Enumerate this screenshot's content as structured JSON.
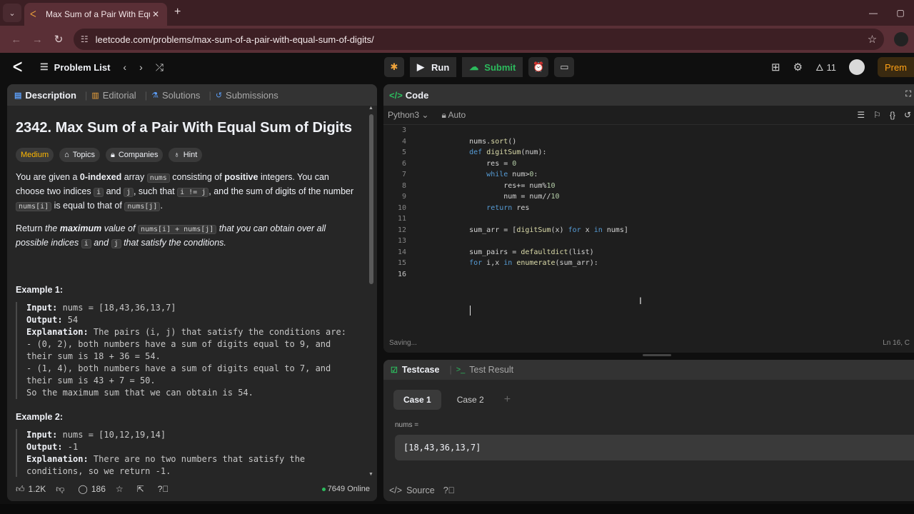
{
  "browser": {
    "tab_title": "Max Sum of a Pair With Equal Sum of Digits",
    "tab_close": "✕",
    "new_tab": "+",
    "url": "leetcode.com/problems/max-sum-of-a-pair-with-equal-sum-of-digits/",
    "icons": [
      "menu-chevron-icon",
      "favicon-icon",
      "back-icon",
      "forward-icon",
      "reload-icon",
      "site-info-icon",
      "bookmark-star-icon",
      "minimize-icon",
      "maximize-icon"
    ]
  },
  "nav": {
    "problem_list": "Problem List",
    "run": "Run",
    "submit": "Submit",
    "streak": "11",
    "premium": "Prem"
  },
  "description_panel": {
    "tabs": {
      "description": "Description",
      "editorial": "Editorial",
      "solutions": "Solutions",
      "submissions": "Submissions"
    },
    "title": "2342. Max Sum of a Pair With Equal Sum of Digits",
    "badges": {
      "difficulty": "Medium",
      "topics": "Topics",
      "companies": "Companies",
      "hint": "Hint"
    },
    "para1": {
      "t1": "You are given a ",
      "b1": "0-indexed",
      "t2": " array ",
      "c1": "nums",
      "t3": " consisting of ",
      "b2": "positive",
      "t4": " integers. You can choose two indices ",
      "c2": "i",
      "t5": " and ",
      "c3": "j",
      "t6": ", such that ",
      "c4": "i != j",
      "t7": ", and the sum of digits of the number ",
      "c5": "nums[i]",
      "t8": " is equal to that of ",
      "c6": "nums[j]",
      "t9": "."
    },
    "para2": {
      "t1": "Return ",
      "i1": "the ",
      "b1": "maximum",
      "i2": " value of ",
      "c1": "nums[i] + nums[j]",
      "i3": " that you can obtain over all possible indices ",
      "c2": "i",
      "i4": " and ",
      "c3": "j",
      "i5": " that satisfy the conditions."
    },
    "example1": {
      "heading": "Example 1:",
      "input_label": "Input:",
      "input": " nums = [18,43,36,13,7]",
      "output_label": "Output:",
      "output": " 54",
      "explanation_label": "Explanation:",
      "explanation": " The pairs (i, j) that satisfy the conditions are:\n- (0, 2), both numbers have a sum of digits equal to 9, and their sum is 18 + 36 = 54.\n- (1, 4), both numbers have a sum of digits equal to 7, and their sum is 43 + 7 = 50.\nSo the maximum sum that we can obtain is 54."
    },
    "example2": {
      "heading": "Example 2:",
      "input_label": "Input:",
      "input": " nums = [10,12,19,14]",
      "output_label": "Output:",
      "output": " -1",
      "explanation_label": "Explanation:",
      "explanation": " There are no two numbers that satisfy the conditions, so we return -1."
    },
    "footer": {
      "likes": "1.2K",
      "comments": "186",
      "online": "7649 Online"
    }
  },
  "code_panel": {
    "header": "Code",
    "language": "Python3",
    "mode": "Auto",
    "status_left": "Saving...",
    "status_right": "Ln 16, C",
    "lines": [
      {
        "n": "3"
      },
      {
        "n": "4"
      },
      {
        "n": "5"
      },
      {
        "n": "6"
      },
      {
        "n": "7"
      },
      {
        "n": "8"
      },
      {
        "n": "9"
      },
      {
        "n": "10"
      },
      {
        "n": "11"
      },
      {
        "n": "12"
      },
      {
        "n": "13"
      },
      {
        "n": "14"
      },
      {
        "n": "15"
      },
      {
        "n": "16"
      }
    ]
  },
  "test_panel": {
    "tab_testcase": "Testcase",
    "tab_result": "Test Result",
    "case1": "Case 1",
    "case2": "Case 2",
    "add": "+",
    "param_label": "nums =",
    "param_value": "[18,43,36,13,7]",
    "source": "Source"
  }
}
